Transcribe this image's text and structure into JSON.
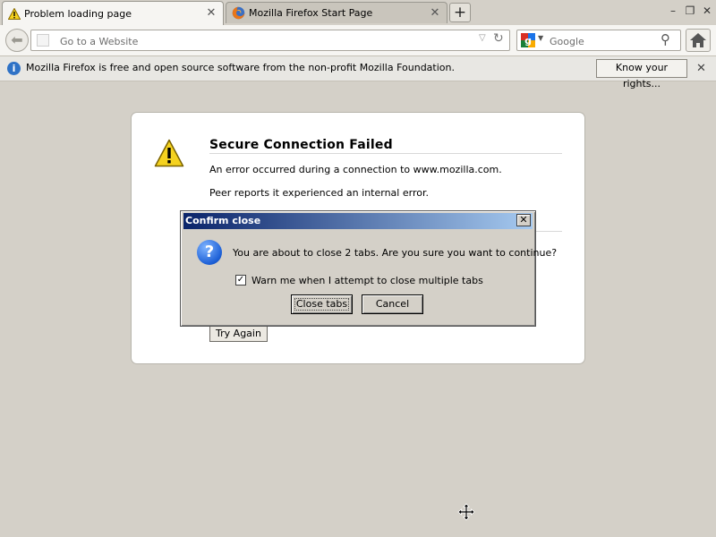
{
  "browser": {
    "tabs": [
      {
        "label": "Problem loading page",
        "active": true,
        "icon": "warning-icon"
      },
      {
        "label": "Mozilla Firefox Start Page",
        "active": false,
        "icon": "firefox-icon"
      }
    ],
    "new_tab_label": "+"
  },
  "navbar": {
    "url_placeholder": "Go to a Website",
    "search_placeholder": "Google"
  },
  "notification": {
    "text": "Mozilla Firefox is free and open source software from the non-profit Mozilla Foundation.",
    "button_label": "Know your rights..."
  },
  "error_page": {
    "title": "Secure Connection Failed",
    "line1": "An error occurred during a connection to www.mozilla.com.",
    "line2": "Peer reports it experienced an internal error.",
    "try_again_label": "Try Again"
  },
  "dialog": {
    "title": "Confirm close",
    "message": "You are about to close 2 tabs. Are you sure you want to continue?",
    "checkbox_label": "Warn me when I attempt to close multiple tabs",
    "checkbox_checked": true,
    "confirm_label": "Close tabs",
    "cancel_label": "Cancel"
  },
  "colors": {
    "background": "#d4d0c8",
    "dialog_title_start": "#0a246a",
    "dialog_title_end": "#a6caf0",
    "warning_yellow": "#f5d21f"
  }
}
